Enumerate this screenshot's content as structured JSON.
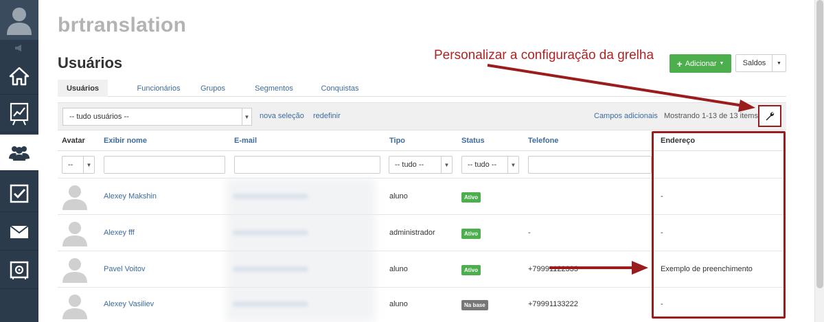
{
  "app_title": "brtranslation",
  "page_title": "Usuários",
  "annotation": {
    "text": "Personalizar a configuração da grelha",
    "color": "#b22222"
  },
  "header_buttons": {
    "add_label": "Adicionar",
    "saldos_label": "Saldos"
  },
  "tabs": [
    {
      "label": "Usuários",
      "active": true
    },
    {
      "label": "Funcionários"
    },
    {
      "label": "Grupos"
    },
    {
      "label": "Segmentos"
    },
    {
      "label": "Conquistas"
    }
  ],
  "filterbar": {
    "user_select_value": "-- tudo usuários --",
    "new_selection": "nova seleção",
    "reset": "redefinir",
    "extra_fields": "Campos adicionais",
    "showing": "Mostrando 1-13 de 13 items."
  },
  "columns": {
    "avatar": "Avatar",
    "name": "Exibir nome",
    "email": "E-mail",
    "type": "Tipo",
    "status": "Status",
    "phone": "Telefone",
    "address": "Endereço"
  },
  "column_filters": {
    "avatar": "--",
    "type": "-- tudo --",
    "status": "-- tudo --"
  },
  "rows": [
    {
      "name": "Alexey Makshin",
      "type": "aluno",
      "status": "Ativo",
      "status_color": "green",
      "phone": "",
      "address": "-"
    },
    {
      "name": "Alexey fff",
      "type": "administrador",
      "status": "Ativo",
      "status_color": "green",
      "phone": "-",
      "address": "-"
    },
    {
      "name": "Pavel Voitov",
      "type": "aluno",
      "status": "Ativo",
      "status_color": "green",
      "phone": "+79991122333",
      "address": "Exemplo de preenchimento"
    },
    {
      "name": "Alexey Vasiliev",
      "type": "aluno",
      "status": "Na base",
      "status_color": "gray",
      "phone": "+79991133222",
      "address": "-"
    }
  ],
  "colors": {
    "sidebar": "#2b3b4c",
    "link": "#3d6b9e",
    "success": "#4cae4c",
    "annotation_red": "#9b1c1c"
  }
}
